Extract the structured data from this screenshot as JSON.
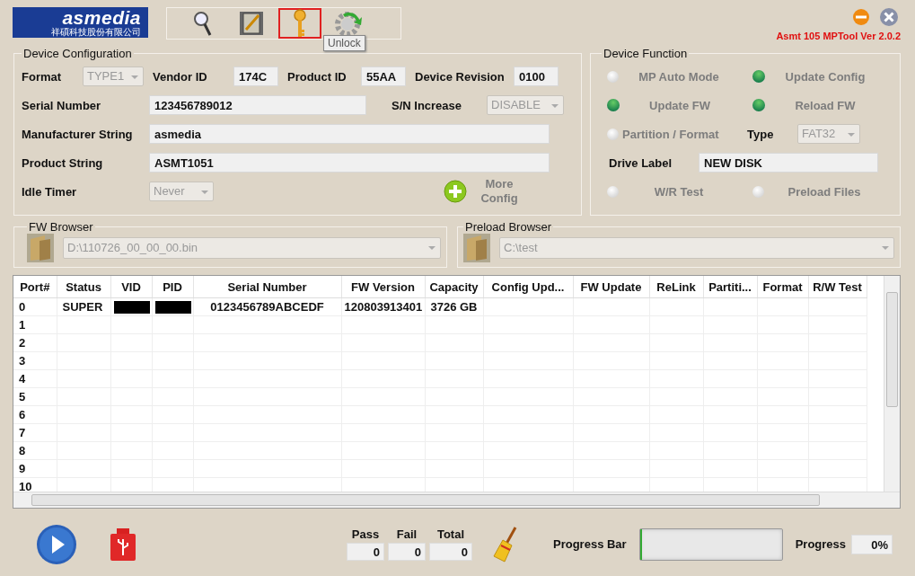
{
  "logo": {
    "name": "asmedia",
    "subtitle": "祥碩科技股份有限公司"
  },
  "toolbar": [
    {
      "selected": false
    },
    {
      "selected": false
    },
    {
      "selected": true
    },
    {
      "selected": false
    }
  ],
  "tooltip": "Unlock",
  "version": "Asmt 105 MPTool Ver 2.0.2",
  "device_configuration": {
    "title": "Device Configuration",
    "format": {
      "label": "Format",
      "value": "TYPE1"
    },
    "vendor_id": {
      "label": "Vendor ID",
      "value": "174C"
    },
    "product_id": {
      "label": "Product ID",
      "value": "55AA"
    },
    "device_revision": {
      "label": "Device Revision",
      "value": "0100"
    },
    "serial_number": {
      "label": "Serial Number",
      "value": "123456789012"
    },
    "sn_increase": {
      "label": "S/N Increase",
      "value": "DISABLE"
    },
    "manufacturer_string": {
      "label": "Manufacturer String",
      "value": "asmedia"
    },
    "product_string": {
      "label": "Product String",
      "value": "ASMT1051"
    },
    "idle_timer": {
      "label": "Idle Timer",
      "value": "Never"
    },
    "more_config": "More Config"
  },
  "device_function": {
    "title": "Device Function",
    "options": [
      {
        "label": "MP Auto Mode",
        "on": false
      },
      {
        "label": "Update Config",
        "on": true
      },
      {
        "label": "Update FW",
        "on": true
      },
      {
        "label": "Reload FW",
        "on": true
      },
      {
        "label": "Partition / Format",
        "on": false
      },
      {
        "label": "W/R Test",
        "on": false
      },
      {
        "label": "Preload Files",
        "on": false
      }
    ],
    "type": {
      "label": "Type",
      "value": "FAT32"
    },
    "drive_label": {
      "label": "Drive Label",
      "value": "NEW DISK"
    }
  },
  "fw_browser": {
    "title": "FW Browser",
    "path": "D:\\110726_00_00_00.bin"
  },
  "preload_browser": {
    "title": "Preload Browser",
    "path": "C:\\test"
  },
  "table": {
    "columns": [
      "Port#",
      "Status",
      "VID",
      "PID",
      "Serial Number",
      "FW Version",
      "Capacity",
      "Config Upd...",
      "FW Update",
      "ReLink",
      "Partiti...",
      "Format",
      "R/W Test"
    ],
    "rows": [
      {
        "cells": [
          "0",
          "SUPER",
          {
            "redacted": true
          },
          {
            "redacted": true
          },
          "0123456789ABCEDF",
          "120803913401",
          "3726 GB"
        ]
      },
      {
        "cells": [
          "1"
        ]
      },
      {
        "cells": [
          "2"
        ]
      },
      {
        "cells": [
          "3"
        ]
      },
      {
        "cells": [
          "4"
        ]
      },
      {
        "cells": [
          "5"
        ]
      },
      {
        "cells": [
          "6"
        ]
      },
      {
        "cells": [
          "7"
        ]
      },
      {
        "cells": [
          "8"
        ]
      },
      {
        "cells": [
          "9"
        ]
      },
      {
        "cells": [
          "10"
        ]
      }
    ]
  },
  "counters": [
    {
      "label": "Pass",
      "value": "0"
    },
    {
      "label": "Fail",
      "value": "0"
    },
    {
      "label": "Total",
      "value": "0"
    }
  ],
  "progress_bar": {
    "label": "Progress Bar",
    "level": 0
  },
  "progress": {
    "label": "Progress",
    "value": "0%"
  }
}
